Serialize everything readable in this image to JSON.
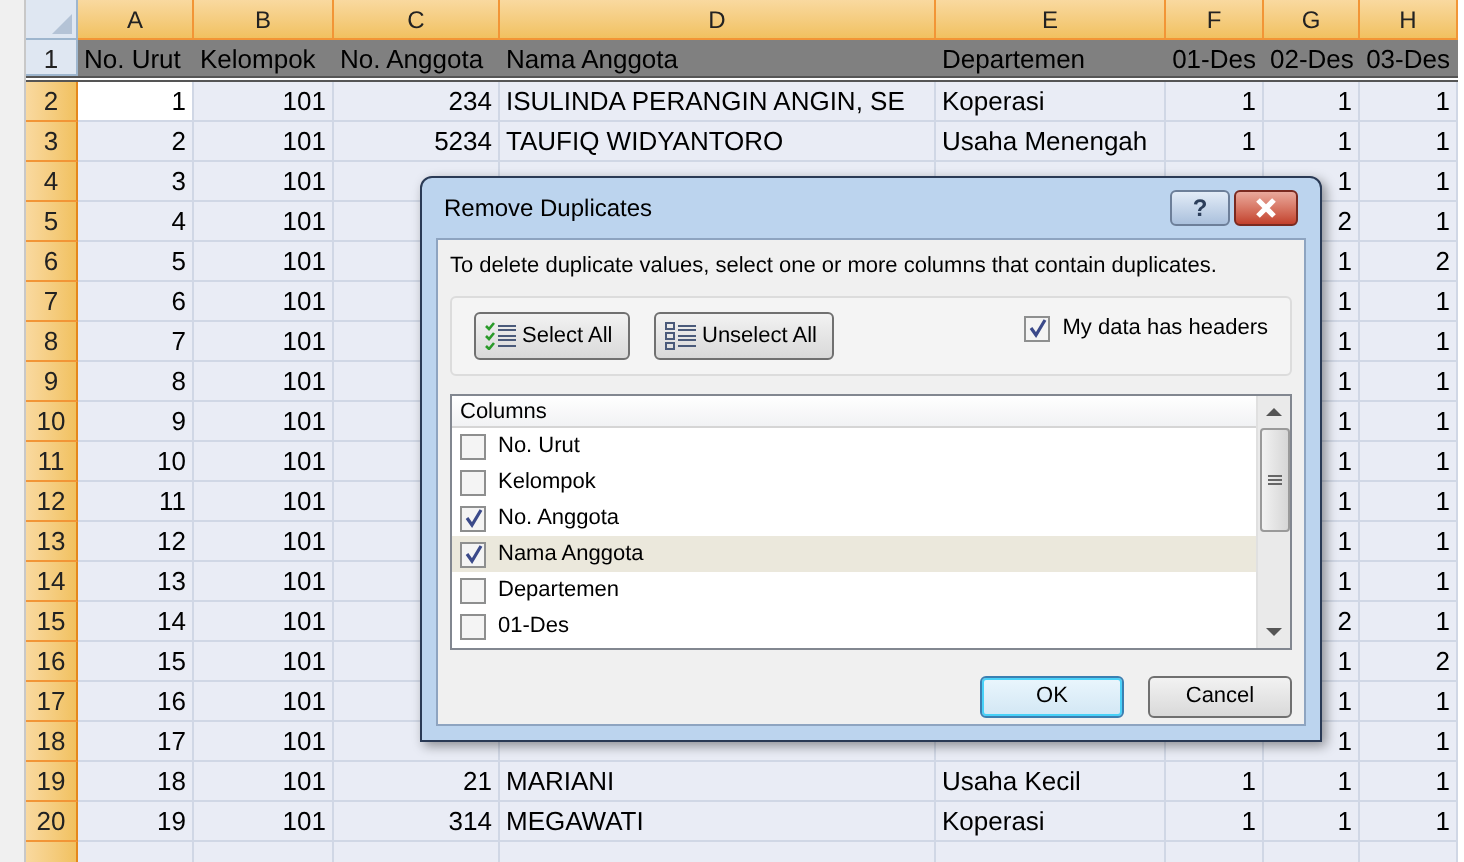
{
  "sheet": {
    "columns": [
      {
        "letter": "A",
        "selected": true
      },
      {
        "letter": "B",
        "selected": true
      },
      {
        "letter": "C",
        "selected": true
      },
      {
        "letter": "D",
        "selected": true
      },
      {
        "letter": "E",
        "selected": true
      },
      {
        "letter": "F",
        "selected": true
      },
      {
        "letter": "G",
        "selected": true
      },
      {
        "letter": "H",
        "selected": true
      }
    ],
    "rows": [
      {
        "number": "1",
        "kind": "header",
        "selected": false,
        "cells": [
          "No. Urut",
          "Kelompok",
          "No. Anggota",
          "Nama Anggota",
          "Departemen",
          "01-Des",
          "02-Des",
          "03-Des"
        ]
      },
      {
        "number": "2",
        "kind": "data",
        "selected": true,
        "cursor_in_column_a": true,
        "cells": [
          "1",
          "101",
          "234",
          "ISULINDA PERANGIN ANGIN, SE",
          "Koperasi",
          "1",
          "1",
          "1"
        ]
      },
      {
        "number": "3",
        "kind": "data",
        "selected": true,
        "cursor_in_column_a": false,
        "cells": [
          "2",
          "101",
          "5234",
          "TAUFIQ WIDYANTORO",
          "Usaha Menengah",
          "1",
          "1",
          "1"
        ]
      },
      {
        "number": "4",
        "kind": "data",
        "selected": true,
        "cursor_in_column_a": false,
        "cells": [
          "3",
          "101",
          null,
          null,
          null,
          null,
          "1",
          "1"
        ]
      },
      {
        "number": "5",
        "kind": "data",
        "selected": true,
        "cursor_in_column_a": false,
        "cells": [
          "4",
          "101",
          null,
          null,
          null,
          null,
          "2",
          "1"
        ]
      },
      {
        "number": "6",
        "kind": "data",
        "selected": true,
        "cursor_in_column_a": false,
        "cells": [
          "5",
          "101",
          null,
          null,
          null,
          null,
          "1",
          "2"
        ]
      },
      {
        "number": "7",
        "kind": "data",
        "selected": true,
        "cursor_in_column_a": false,
        "cells": [
          "6",
          "101",
          null,
          null,
          null,
          null,
          "1",
          "1"
        ]
      },
      {
        "number": "8",
        "kind": "data",
        "selected": true,
        "cursor_in_column_a": false,
        "cells": [
          "7",
          "101",
          null,
          null,
          null,
          null,
          "1",
          "1"
        ]
      },
      {
        "number": "9",
        "kind": "data",
        "selected": true,
        "cursor_in_column_a": false,
        "cells": [
          "8",
          "101",
          null,
          null,
          null,
          null,
          "1",
          "1"
        ]
      },
      {
        "number": "10",
        "kind": "data",
        "selected": true,
        "cursor_in_column_a": false,
        "cells": [
          "9",
          "101",
          null,
          null,
          null,
          null,
          "1",
          "1"
        ]
      },
      {
        "number": "11",
        "kind": "data",
        "selected": true,
        "cursor_in_column_a": false,
        "cells": [
          "10",
          "101",
          null,
          null,
          null,
          null,
          "1",
          "1"
        ]
      },
      {
        "number": "12",
        "kind": "data",
        "selected": true,
        "cursor_in_column_a": false,
        "cells": [
          "11",
          "101",
          null,
          null,
          null,
          null,
          "1",
          "1"
        ]
      },
      {
        "number": "13",
        "kind": "data",
        "selected": true,
        "cursor_in_column_a": false,
        "cells": [
          "12",
          "101",
          null,
          null,
          null,
          null,
          "1",
          "1"
        ]
      },
      {
        "number": "14",
        "kind": "data",
        "selected": true,
        "cursor_in_column_a": false,
        "cells": [
          "13",
          "101",
          null,
          null,
          null,
          null,
          "1",
          "1"
        ]
      },
      {
        "number": "15",
        "kind": "data",
        "selected": true,
        "cursor_in_column_a": false,
        "cells": [
          "14",
          "101",
          null,
          null,
          null,
          null,
          "2",
          "1"
        ]
      },
      {
        "number": "16",
        "kind": "data",
        "selected": true,
        "cursor_in_column_a": false,
        "cells": [
          "15",
          "101",
          null,
          null,
          null,
          null,
          "1",
          "2"
        ]
      },
      {
        "number": "17",
        "kind": "data",
        "selected": true,
        "cursor_in_column_a": false,
        "cells": [
          "16",
          "101",
          null,
          null,
          null,
          null,
          "1",
          "1"
        ]
      },
      {
        "number": "18",
        "kind": "data",
        "selected": true,
        "cursor_in_column_a": false,
        "cells": [
          "17",
          "101",
          null,
          null,
          null,
          null,
          "1",
          "1"
        ]
      },
      {
        "number": "19",
        "kind": "data",
        "selected": true,
        "cursor_in_column_a": false,
        "cells": [
          "18",
          "101",
          "21",
          "MARIANI",
          "Usaha Kecil",
          "1",
          "1",
          "1"
        ]
      },
      {
        "number": "20",
        "kind": "data",
        "selected": true,
        "cursor_in_column_a": false,
        "cells": [
          "19",
          "101",
          "314",
          "MEGAWATI",
          "Koperasi",
          "1",
          "1",
          "1"
        ]
      },
      {
        "number": null,
        "kind": "data",
        "selected": true,
        "cursor_in_column_a": false,
        "cells": [
          null,
          null,
          null,
          null,
          null,
          null,
          null,
          null
        ]
      }
    ]
  },
  "dialog": {
    "title": "Remove Duplicates",
    "help_label": "?",
    "instruction": "To delete duplicate values, select one or more columns that contain duplicates.",
    "select_all_button": "Select All",
    "unselect_all_button": "Unselect All",
    "has_headers": {
      "label": "My data has headers",
      "checked": true
    },
    "columns_list": {
      "header": "Columns",
      "items": [
        {
          "label": "No. Urut",
          "checked": false,
          "selected": false
        },
        {
          "label": "Kelompok",
          "checked": false,
          "selected": false
        },
        {
          "label": "No. Anggota",
          "checked": true,
          "selected": false
        },
        {
          "label": "Nama Anggota",
          "checked": true,
          "selected": true
        },
        {
          "label": "Departemen",
          "checked": false,
          "selected": false
        },
        {
          "label": "01-Des",
          "checked": false,
          "selected": false
        }
      ]
    },
    "ok_button": "OK",
    "cancel_button": "Cancel"
  }
}
